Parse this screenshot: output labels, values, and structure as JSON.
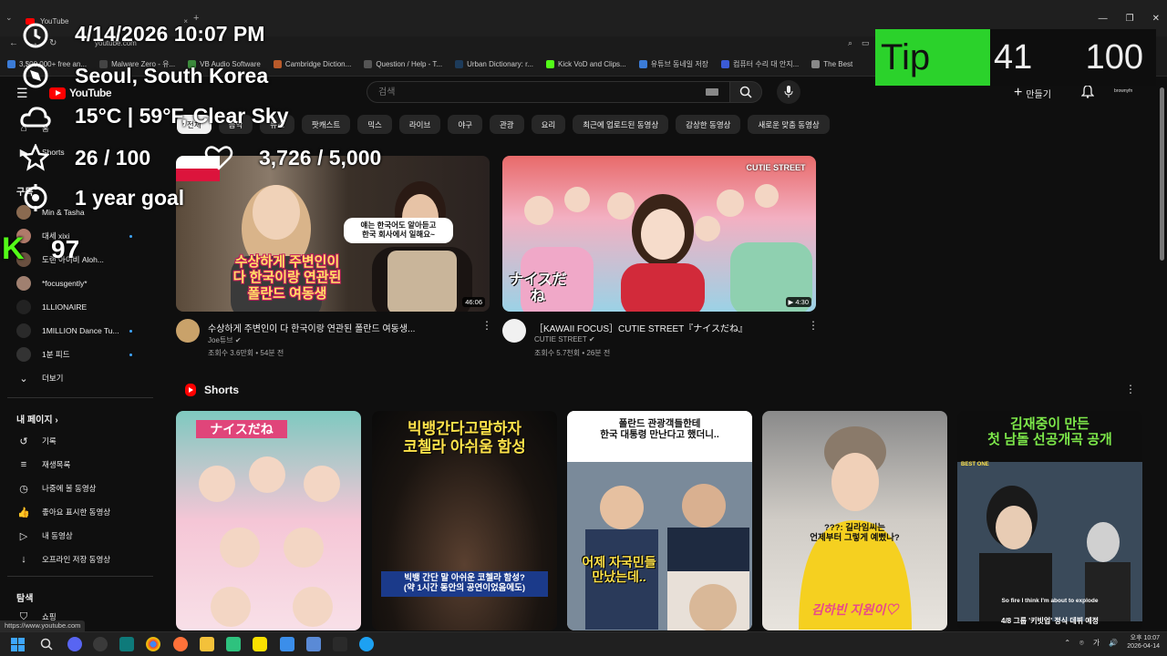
{
  "browser": {
    "tab_title": "YouTube",
    "url": "youtube.com",
    "bookmarks": [
      {
        "label": "3,$00,000+ free an...",
        "color": "#3b7bd6"
      },
      {
        "label": "Malware Zero - 유...",
        "color": "#444"
      },
      {
        "label": "VB Audio Software",
        "color": "#3c8a3c"
      },
      {
        "label": "Cambridge Diction...",
        "color": "#b85a2a"
      },
      {
        "label": "Question / Help - T...",
        "color": "#555"
      },
      {
        "label": "Urban Dictionary: r...",
        "color": "#1d3b5a"
      },
      {
        "label": "Kick VoD and Clips...",
        "color": "#53fc18"
      },
      {
        "label": "유튜브 동네일 저장",
        "color": "#3b7bd6"
      },
      {
        "label": "컴퓨터 수리 대 안지...",
        "color": "#3b5bd6"
      },
      {
        "label": "The Best",
        "color": "#888"
      }
    ]
  },
  "youtube": {
    "logo_text": "YouTube",
    "search_placeholder": "검색",
    "create_label": "만들기",
    "account_label": "brownyfn"
  },
  "chips": [
    "전체",
    "음악",
    "뉴스",
    "믹스",
    "라이브",
    "야구",
    "관광",
    "요리",
    "최근에 업로드된 동영상",
    "감상한 동영상",
    "새로운 맞춤 동영상"
  ],
  "chips_shown": [
    "전체",
    "음악",
    "뉴스",
    "팟캐스트",
    "믹스",
    "라이브",
    "야구",
    "관광",
    "요리",
    "최근에 업로드된 동영상",
    "감상한 동영상",
    "새로운 맞춤 동영상"
  ],
  "sidebar": {
    "top": [
      {
        "label": "홈",
        "icon": "home-icon"
      },
      {
        "label": "Shorts",
        "icon": "shorts-icon"
      }
    ],
    "subs_heading": "구독",
    "subscriptions": [
      {
        "label": "Min & Tasha",
        "color": "#8a6a50",
        "dot": false
      },
      {
        "label": "대세 xixi",
        "color": "#b07a6a",
        "dot": true
      },
      {
        "label": "도랜 아이비 Aloh...",
        "color": "#6a5040",
        "dot": false
      },
      {
        "label": "*focusgently*",
        "color": "#a08070",
        "dot": false
      },
      {
        "label": "1LLIONAIRE",
        "color": "#222",
        "dot": false
      },
      {
        "label": "1MILLION Dance Tu...",
        "color": "#2a2a2a",
        "dot": true
      },
      {
        "label": "1분 피드",
        "color": "#333",
        "dot": true
      }
    ],
    "more_label": "더보기",
    "me_heading": "내 페이지",
    "me_items": [
      {
        "label": "기록",
        "icon": "history-icon"
      },
      {
        "label": "재생목록",
        "icon": "playlist-icon"
      },
      {
        "label": "나중에 볼 동영상",
        "icon": "watch-later-icon"
      },
      {
        "label": "좋아요 표시한 동영상",
        "icon": "thumbs-up-icon"
      },
      {
        "label": "내 동영상",
        "icon": "my-videos-icon"
      },
      {
        "label": "오프라인 저장 동영상",
        "icon": "download-icon"
      }
    ],
    "explore_heading": "탐색",
    "explore_items": [
      {
        "label": "쇼핑",
        "icon": "shopping-icon"
      }
    ]
  },
  "videos": [
    {
      "title": "수상하게 주변인이 다 한국이랑 연관된 폴란드 여동생...",
      "channel": "Joe튜브",
      "meta": "조회수 3.6만회 • 54분 전",
      "duration": "46:06",
      "caption": "수상하게 주변인이\n다 한국이랑 연관된\n폴란드 여동생",
      "bubble": "얘는 한국어도 알아듣고\n한국 회사에서 일해요~"
    },
    {
      "title": "［KAWAII FOCUS］CUTIE STREET『ナイスだね』",
      "channel": "CUTIE STREET",
      "meta": "조회수 5.7천회 • 26분 전",
      "duration": "4:30",
      "caption": "ナイスだね",
      "brand": "CUTIE STREET"
    }
  ],
  "shorts": {
    "heading": "Shorts",
    "items": [
      {
        "top": "ナイスだね",
        "bottom": ""
      },
      {
        "top": "빅뱅간다고말하자\n코첼라 아쉬움 함성",
        "bottom": "빅뱅 간단 말 아쉬운 코첼라 함성?\n(약 1시간 동안의 공연이었음에도)"
      },
      {
        "top": "폴란드 관광객들한테\n한국 대통령 만난다고 했더니..",
        "bottom": "어제 자국민들\n만났는데.."
      },
      {
        "top": "",
        "bottom": "???: 길라임씨는\n언제부터 그렇게 예뻤나?"
      },
      {
        "top": "김재중이 만든\n첫 남돌 선공개곡 공개",
        "bottom": "4/8 그룹 '키빗업' 정식 데뷔 예정"
      }
    ],
    "short4_sign": "김하빈 지원이♡",
    "short5_sub": "So fire I think I'm about to explode",
    "short5_badge": "BEST ONE"
  },
  "overlay": {
    "datetime": "4/14/2026 10:07 PM",
    "location": "Seoul, South Korea",
    "weather": "15°C | 59°F, Clear Sky",
    "stars": "26 / 100",
    "hearts": "3,726 / 5,000",
    "goal": "1 year goal",
    "kick_count": "97",
    "tip_label": "Tip",
    "tip_current": "41",
    "tip_goal": "100"
  },
  "status_url": "https://www.youtube.com",
  "taskbar": {
    "time": "오후 10:07",
    "date": "2026-04-14",
    "ime": "가"
  }
}
